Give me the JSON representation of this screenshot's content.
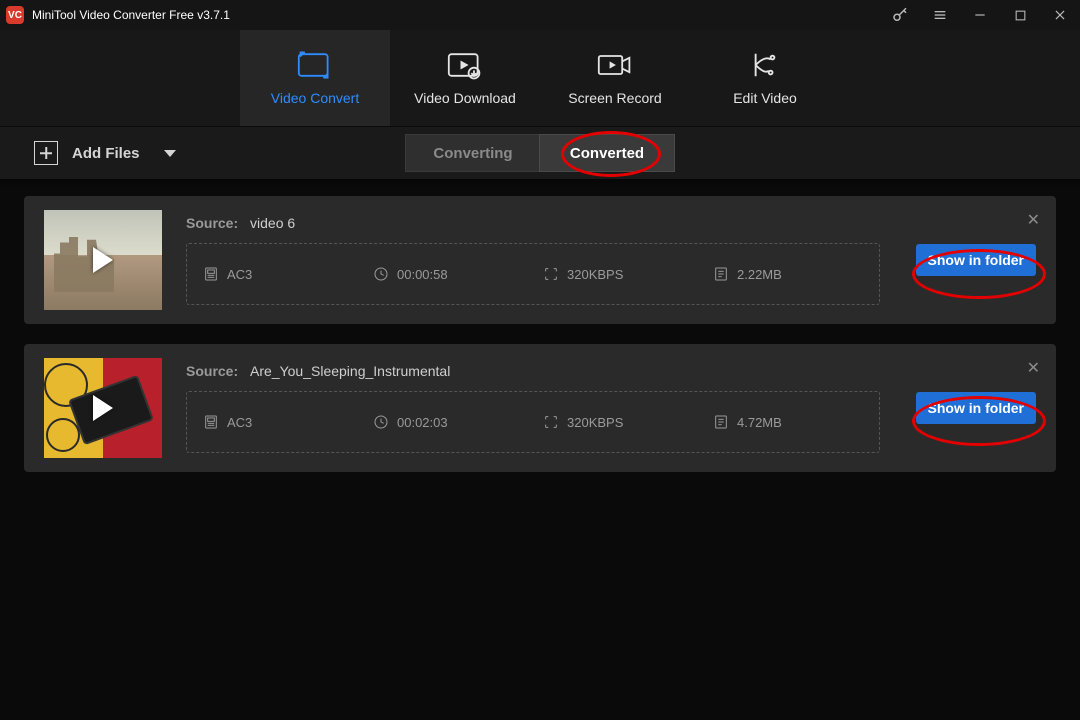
{
  "app": {
    "title": "MiniTool Video Converter Free v3.7.1"
  },
  "nav": {
    "convert": "Video Convert",
    "download": "Video Download",
    "record": "Screen Record",
    "edit": "Edit Video"
  },
  "toolbar": {
    "add_files": "Add Files"
  },
  "tabs": {
    "converting": "Converting",
    "converted": "Converted"
  },
  "labels": {
    "source": "Source:",
    "show_in_folder": "Show in folder"
  },
  "items": [
    {
      "name": "video 6",
      "format": "AC3",
      "duration": "00:00:58",
      "bitrate": "320KBPS",
      "size": "2.22MB"
    },
    {
      "name": "Are_You_Sleeping_Instrumental",
      "format": "AC3",
      "duration": "00:02:03",
      "bitrate": "320KBPS",
      "size": "4.72MB"
    }
  ]
}
